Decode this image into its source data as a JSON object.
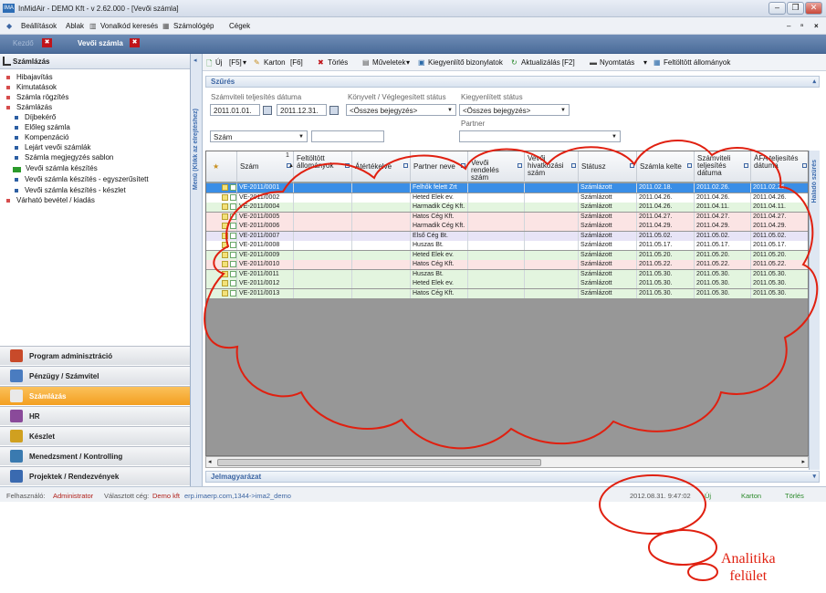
{
  "window": {
    "title": "InMidAir - DEMO Kft - v 2.62.000 - [Vevői számla]",
    "app_icon": "IMA"
  },
  "menu": {
    "items": [
      "Beállítások",
      "Ablak",
      "Vonalkód keresés",
      "Számológép",
      "Cégek"
    ]
  },
  "tabs": [
    {
      "label": "Kezdő"
    },
    {
      "label": "Vevői számla"
    }
  ],
  "left_panel": {
    "header": "Számlázás",
    "tree": [
      {
        "label": "Hibajavítás",
        "level": 0
      },
      {
        "label": "Kimutatások",
        "level": 0
      },
      {
        "label": "Számla rögzítés",
        "level": 0
      },
      {
        "label": "Számlázás",
        "level": 0
      },
      {
        "label": "Díjbekérő",
        "level": 1
      },
      {
        "label": "Előleg számla",
        "level": 1
      },
      {
        "label": "Kompenzáció",
        "level": 1
      },
      {
        "label": "Lejárt vevői számlák",
        "level": 1
      },
      {
        "label": "Számla megjegyzés sablon",
        "level": 1
      },
      {
        "label": "Vevői számla készítés",
        "level": 1
      },
      {
        "label": "Vevői számla készítés - egyszerűsített",
        "level": 1
      },
      {
        "label": "Vevői számla készítés - készlet",
        "level": 1
      },
      {
        "label": "Várható bevétel / kiadás",
        "level": 0
      }
    ],
    "nav": [
      {
        "label": "Program adminisztráció",
        "active": false
      },
      {
        "label": "Pénzügy / Számvitel",
        "active": false
      },
      {
        "label": "Számlázás",
        "active": true
      },
      {
        "label": "HR",
        "active": false
      },
      {
        "label": "Készlet",
        "active": false
      },
      {
        "label": "Menedzsment / Kontrolling",
        "active": false
      },
      {
        "label": "Projektek / Rendezvények",
        "active": false
      }
    ],
    "vertical_label": "Menü (Klikk az elrejtéshez)"
  },
  "toolbar": {
    "items": [
      "Új",
      "[F5]",
      "Karton",
      "[F6]",
      "Törlés",
      "Műveletek",
      "Kiegyenlítő bizonylatok",
      "Aktualizálás [F2]",
      "Nyomtatás",
      "Feltöltött állományok"
    ]
  },
  "filter": {
    "title": "Szűrés",
    "date_label": "Számviteli teljesítés dátuma",
    "date_from": "2011.01.01.",
    "date_to": "2011.12.31.",
    "status_label": "Könyvelt / Véglegesített státus",
    "status_value": "<Összes bejegyzés>",
    "settle_label": "Kiegyenlített státus",
    "settle_value": "<Összes bejegyzés>",
    "partner_label": "Partner",
    "partner_value": "",
    "field_select": "Szám",
    "field_value": ""
  },
  "grid": {
    "columns": [
      "Szám",
      "Feltöltött állományok",
      "Átértékelve",
      "Partner neve",
      "Vevői rendelés szám",
      "Vevői hivatkozási szám",
      "Státusz",
      "Számla kelte",
      "Számviteli teljesítés dátuma",
      "ÁFA teljesítés dátuma"
    ],
    "sort_indicator": "1",
    "rows": [
      {
        "szam": "VE-2011/0001",
        "partner": "Felhők felett Zrt",
        "statusz": "Számlázott",
        "kelte": "2011.02.18.",
        "szv": "2011.02.26.",
        "afa": "2011.02.26.",
        "color": "sel"
      },
      {
        "szam": "VE-2011/0002",
        "partner": "Heted Elek ev.",
        "statusz": "Számlázott",
        "kelte": "2011.04.26.",
        "szv": "2011.04.26.",
        "afa": "2011.04.26.",
        "color": "white"
      },
      {
        "szam": "VE-2011/0004",
        "partner": "Harmadik Cég Kft.",
        "statusz": "Számlázott",
        "kelte": "2011.04.26.",
        "szv": "2011.04.11.",
        "afa": "2011.04.11.",
        "color": "green"
      },
      {
        "szam": "VE-2011/0005",
        "partner": "Hatos Cég Kft.",
        "statusz": "Számlázott",
        "kelte": "2011.04.27.",
        "szv": "2011.04.27.",
        "afa": "2011.04.27.",
        "color": "pink"
      },
      {
        "szam": "VE-2011/0006",
        "partner": "Harmadik Cég Kft.",
        "statusz": "Számlázott",
        "kelte": "2011.04.29.",
        "szv": "2011.04.29.",
        "afa": "2011.04.29.",
        "color": "pink"
      },
      {
        "szam": "VE-2011/0007",
        "partner": "Első Cég Bt.",
        "statusz": "Számlázott",
        "kelte": "2011.05.02.",
        "szv": "2011.05.02.",
        "afa": "2011.05.02.",
        "color": "lav"
      },
      {
        "szam": "VE-2011/0008",
        "partner": "Huszas Bt.",
        "statusz": "Számlázott",
        "kelte": "2011.05.17.",
        "szv": "2011.05.17.",
        "afa": "2011.05.17.",
        "color": "white"
      },
      {
        "szam": "VE-2011/0009",
        "partner": "Heted Elek ev.",
        "statusz": "Számlázott",
        "kelte": "2011.05.20.",
        "szv": "2011.05.20.",
        "afa": "2011.05.20.",
        "color": "green"
      },
      {
        "szam": "VE-2011/0010",
        "partner": "Hatos Cég Kft.",
        "statusz": "Számlázott",
        "kelte": "2011.05.22.",
        "szv": "2011.05.22.",
        "afa": "2011.05.22.",
        "color": "pink"
      },
      {
        "szam": "VE-2011/0011",
        "partner": "Huszas Bt.",
        "statusz": "Számlázott",
        "kelte": "2011.05.30.",
        "szv": "2011.05.30.",
        "afa": "2011.05.30.",
        "color": "green"
      },
      {
        "szam": "VE-2011/0012",
        "partner": "Heted Elek ev.",
        "statusz": "Számlázott",
        "kelte": "2011.05.30.",
        "szv": "2011.05.30.",
        "afa": "2011.05.30.",
        "color": "green"
      },
      {
        "szam": "VE-2011/0013",
        "partner": "Hatos Cég Kft.",
        "statusz": "Számlázott",
        "kelte": "2011.05.30.",
        "szv": "2011.05.30.",
        "afa": "2011.05.30.",
        "color": "green"
      }
    ]
  },
  "right_strip": "Haladó szűrés",
  "legend_bar": "Jelmagyarázat",
  "status": {
    "user_label": "Felhasználó:",
    "user": "Administrator",
    "company_label": "Választott cég:",
    "company": "Demo kft",
    "server": "erp.imaerp.com,1344->ima2_demo",
    "datetime": "2012.08.31. 9:47:02",
    "new_label": "Új",
    "karton_label": "Karton",
    "delete_label": "Törlés"
  },
  "annotation": {
    "line1": "Analitika",
    "line2": "felület"
  },
  "colors": {
    "sel": "#3a8ee6",
    "green": "#e3f5df",
    "pink": "#fbe4e4",
    "lav": "#e7e4f6",
    "white": "#ffffff",
    "accent": "#f39f21",
    "annot": "#e02010"
  }
}
